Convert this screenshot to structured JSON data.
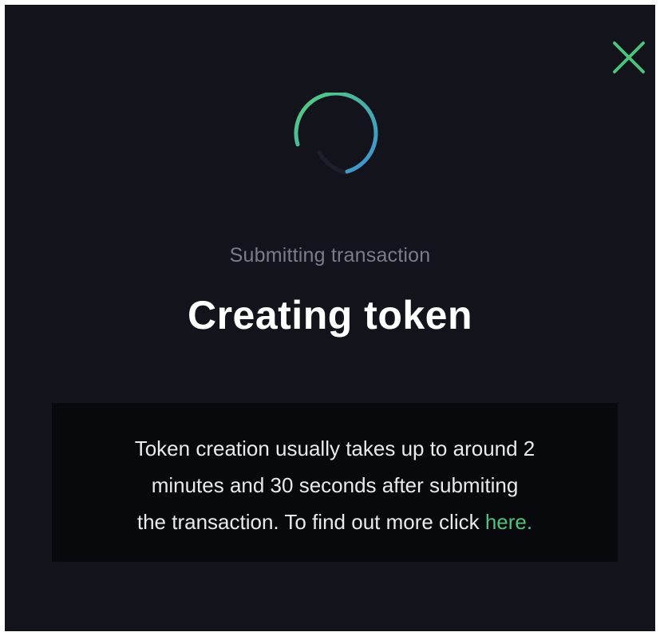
{
  "modal": {
    "close_icon": "close-icon",
    "spinner_icon": "loading-spinner-icon",
    "subtitle": "Submitting transaction",
    "title": "Creating token",
    "info": {
      "line1": "Token creation usually takes up to around 2",
      "line2": "minutes and 30 seconds after submiting",
      "line3_prefix": "the transaction. To find out more click ",
      "link_label": "here."
    }
  },
  "colors": {
    "background": "#12131b",
    "info_background": "#08090d",
    "accent_green": "#4fc27d",
    "spinner_blue": "#3c8fd6",
    "subtitle_gray": "#7a7d88"
  }
}
